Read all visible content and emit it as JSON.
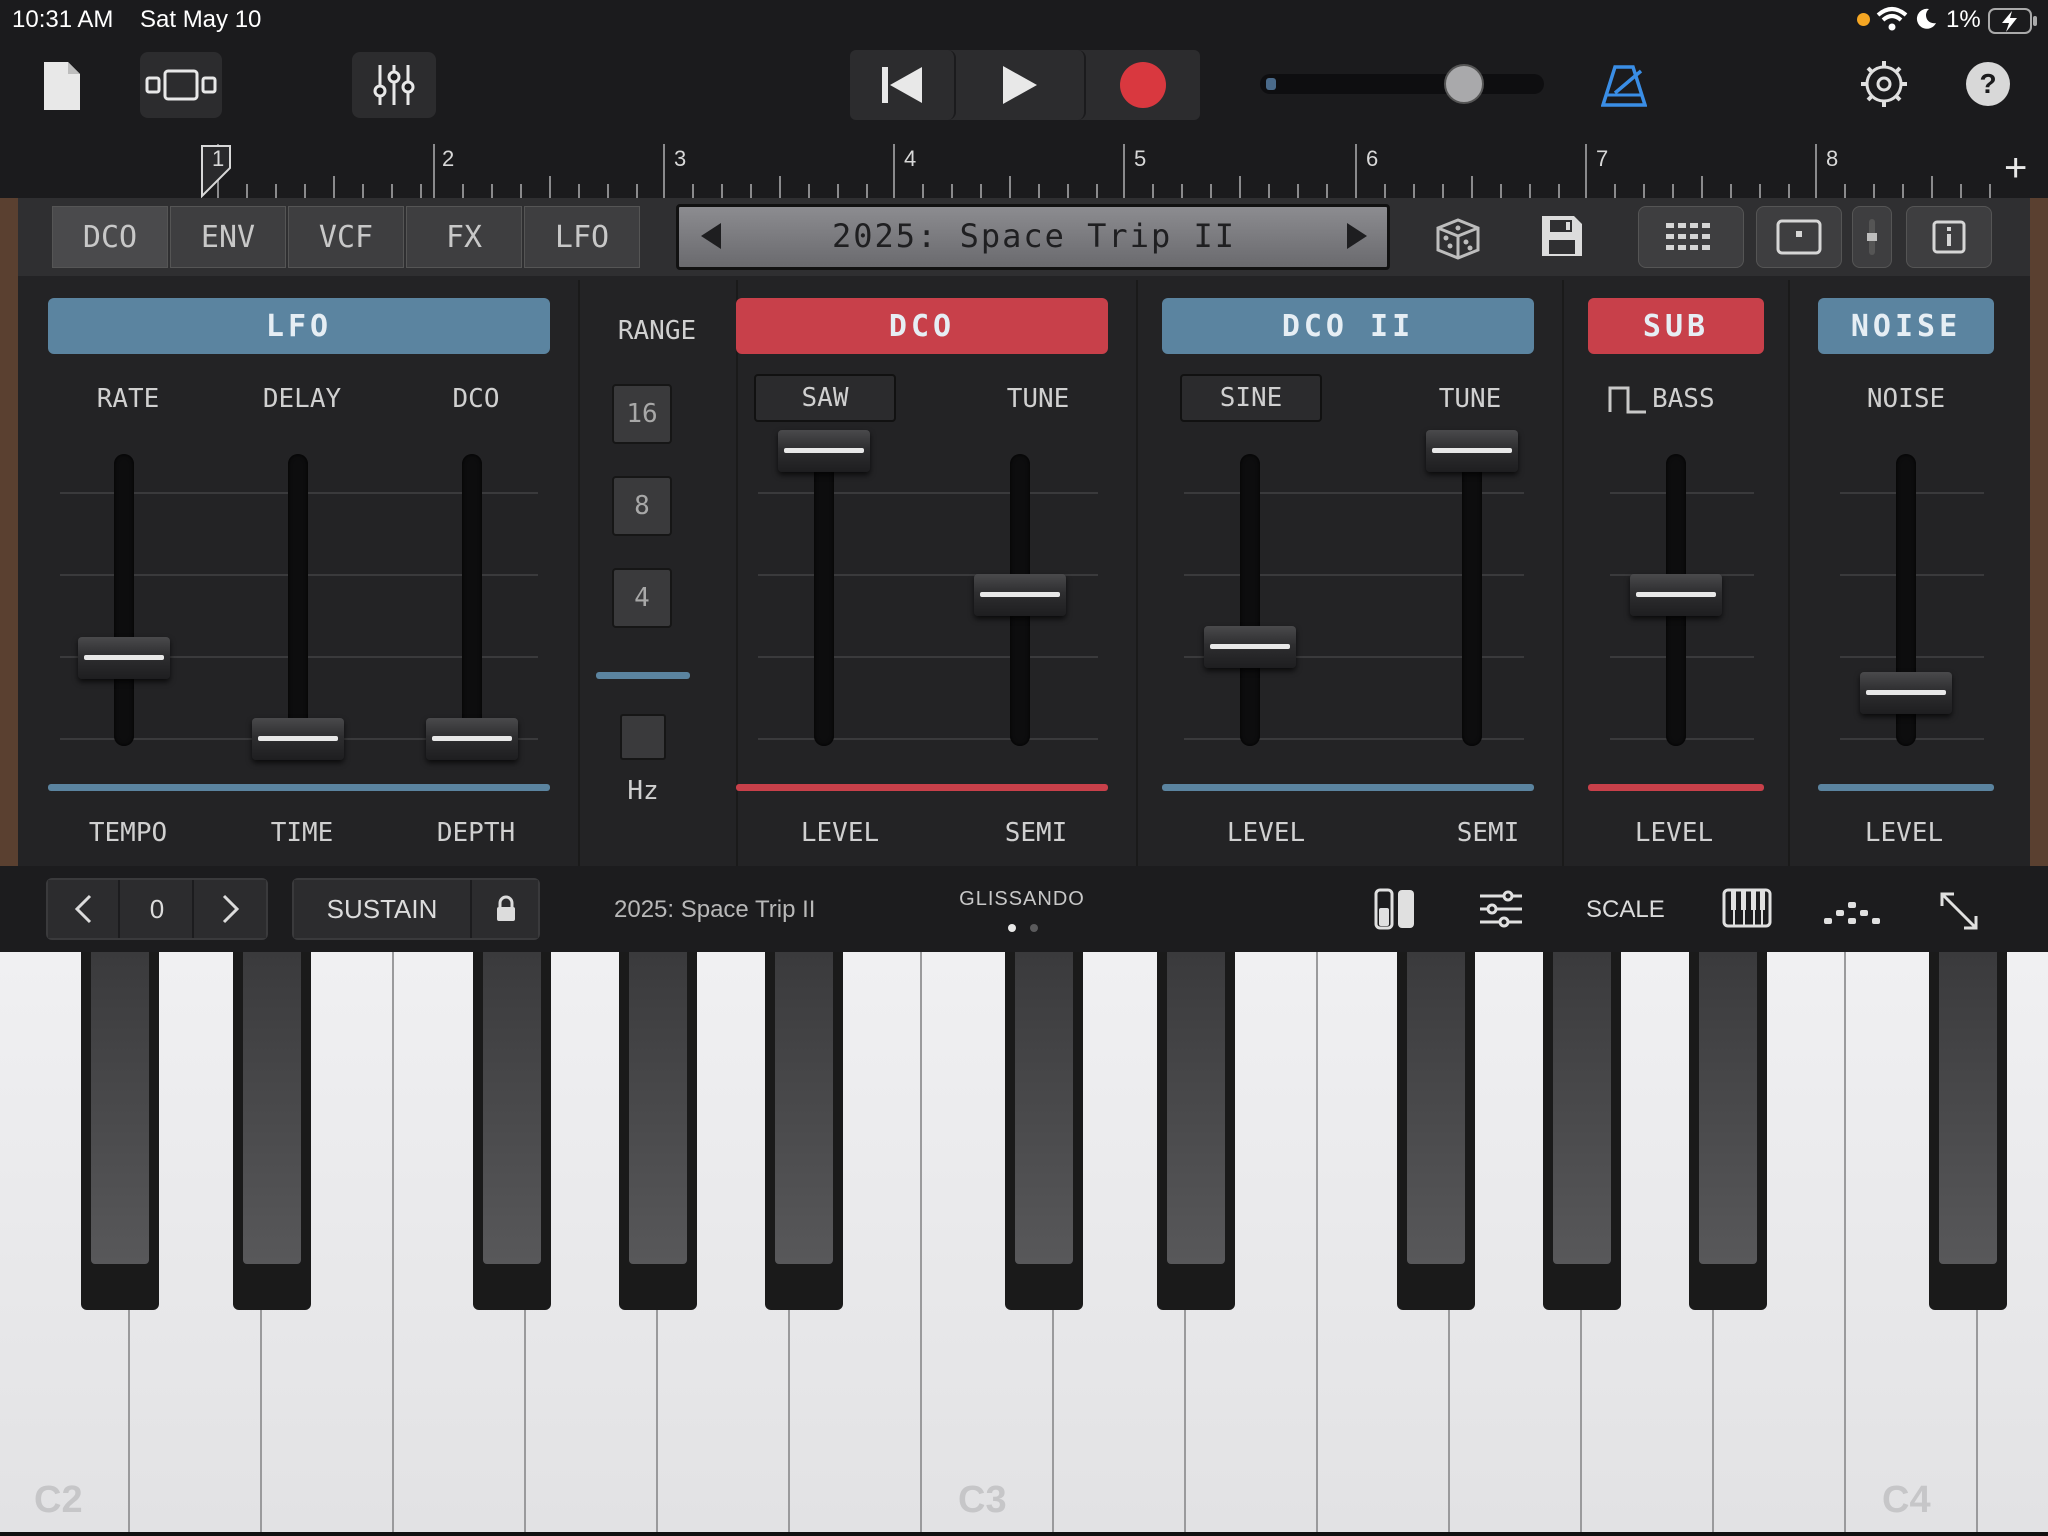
{
  "status_bar": {
    "time": "10:31 AM",
    "date": "Sat May 10",
    "battery": "1%"
  },
  "toolbar": {
    "icons": [
      "document-icon",
      "view-toggle-icon",
      "mixer-icon",
      "rewind-icon",
      "play-icon",
      "record-icon",
      "metronome-icon",
      "settings-icon",
      "help-icon"
    ],
    "help_label": "?",
    "record_color": "#d9383f",
    "metronome_color": "#3a8ee6"
  },
  "ruler": {
    "bars": [
      "1",
      "2",
      "3",
      "4",
      "5",
      "6",
      "7",
      "8"
    ],
    "add_label": "+"
  },
  "synth": {
    "tabs": [
      "DCO",
      "ENV",
      "VCF",
      "FX",
      "LFO"
    ],
    "preset_name": "2025: Space Trip II",
    "lfo": {
      "header": "LFO",
      "sliders": [
        {
          "top": "RATE",
          "bottom": "TEMPO",
          "value": 0.28
        },
        {
          "top": "DELAY",
          "bottom": "TIME",
          "value": 0.0
        },
        {
          "top": "DCO",
          "bottom": "DEPTH",
          "value": 0.0
        }
      ]
    },
    "range": {
      "label": "RANGE",
      "options": [
        "16",
        "8",
        "4"
      ],
      "hz_label": "Hz"
    },
    "dco": {
      "header": "DCO",
      "wave": "SAW",
      "tune_label": "TUNE",
      "level_label": "LEVEL",
      "semi_label": "SEMI",
      "level": 1.0,
      "tune": 0.5
    },
    "dco2": {
      "header": "DCO II",
      "wave": "SINE",
      "tune_label": "TUNE",
      "level_label": "LEVEL",
      "semi_label": "SEMI",
      "level": 0.32,
      "tune": 1.0
    },
    "sub": {
      "header": "SUB",
      "mode": "BASS",
      "level_label": "LEVEL",
      "level": 0.5
    },
    "noise": {
      "header": "NOISE",
      "label": "NOISE",
      "level_label": "LEVEL",
      "level": 0.16
    },
    "colors": {
      "blue": "#5b84a0",
      "red": "#c8404a"
    }
  },
  "control_bar": {
    "octave_value": "0",
    "sustain_label": "SUSTAIN",
    "preset_name": "2025: Space Trip II",
    "glissando_label": "GLISSANDO",
    "scale_label": "SCALE"
  },
  "keyboard": {
    "labels": [
      "C2",
      "C3",
      "C4"
    ]
  }
}
